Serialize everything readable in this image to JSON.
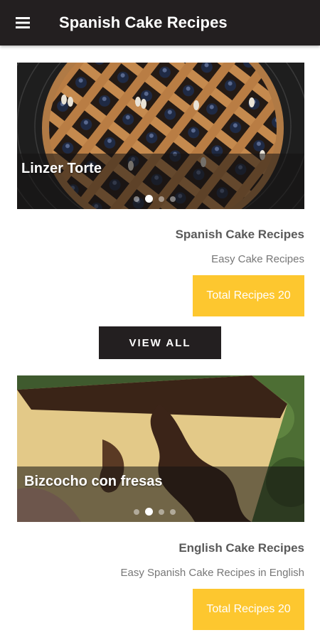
{
  "app": {
    "title": "Spanish Cake Recipes",
    "menu_icon": "hamburger-menu-icon"
  },
  "colors": {
    "appbar": "#231f20",
    "accent": "#fdc72f",
    "button_dark": "#231f20"
  },
  "sections": [
    {
      "slide_caption": "Linzer Torte",
      "slide_count": 4,
      "active_slide": 2,
      "title": "Spanish Cake Recipes",
      "subtitle": "Easy Cake Recipes",
      "count_label": "Total Recipes 20"
    },
    {
      "slide_caption": "Bizcocho con fresas",
      "slide_count": 4,
      "active_slide": 2,
      "title": "English Cake Recipes",
      "subtitle": "Easy Spanish Cake Recipes in English",
      "count_label": "Total Recipes 20"
    }
  ],
  "view_all_label": "VIEW ALL"
}
